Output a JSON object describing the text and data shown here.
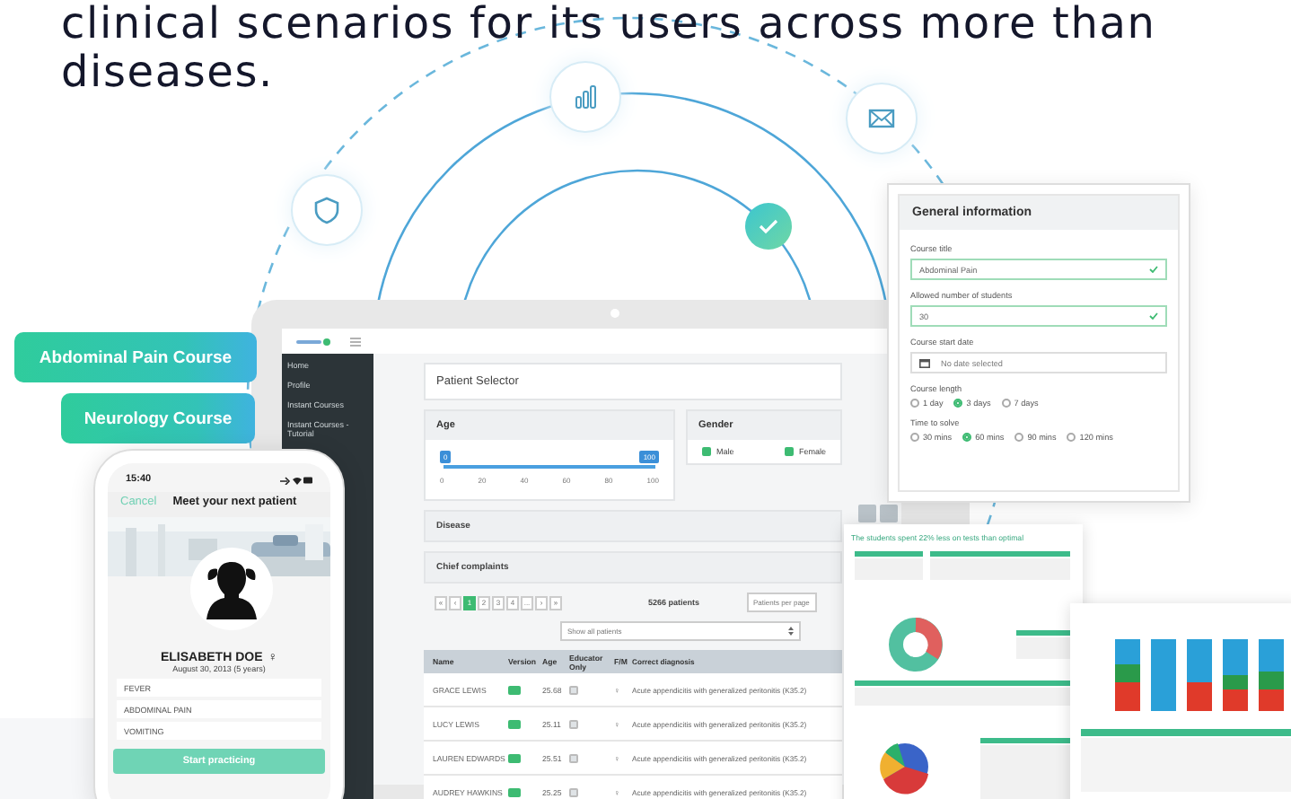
{
  "intro": {
    "lines": [
      "clinical scenarios for its users across more than",
      "diseases."
    ]
  },
  "course_tags": [
    {
      "label": "Abdominal Pain Course"
    },
    {
      "label": "Neurology Course"
    }
  ],
  "phone": {
    "time": "15:40",
    "cancel": "Cancel",
    "title": "Meet your next patient",
    "patient_name": "ELISABETH DOE",
    "gender_symbol": "♀",
    "birth": "August 30, 2013 (5 years)",
    "complaints": [
      "FEVER",
      "ABDOMINAL PAIN",
      "VOMITING"
    ],
    "button": "Start practicing"
  },
  "laptop": {
    "sidebar": [
      {
        "label": "Home"
      },
      {
        "label": "Profile"
      },
      {
        "label": "Instant Courses"
      },
      {
        "label": "Instant Courses - Tutorial"
      }
    ],
    "panel_title": "Patient Selector",
    "age": {
      "label": "Age",
      "min": "0",
      "max": "100",
      "ticks": [
        "0",
        "20",
        "40",
        "60",
        "80",
        "100"
      ]
    },
    "gender": {
      "label": "Gender",
      "options": [
        {
          "label": "Male",
          "checked": true
        },
        {
          "label": "Female",
          "checked": true
        }
      ]
    },
    "sections": [
      "Disease",
      "Chief complaints"
    ],
    "pages": [
      {
        "label": "«",
        "selected": false
      },
      {
        "label": "‹",
        "selected": false
      },
      {
        "label": "1",
        "selected": true
      },
      {
        "label": "2",
        "selected": false
      },
      {
        "label": "3",
        "selected": false
      },
      {
        "label": "4",
        "selected": false
      },
      {
        "label": "...",
        "selected": false
      },
      {
        "label": "›",
        "selected": false
      },
      {
        "label": "»",
        "selected": false
      }
    ],
    "count": "5266 patients",
    "per_page": "Patients per page",
    "filter": "Show all patients",
    "table": {
      "columns": [
        "Name",
        "Version",
        "Age",
        "Educator Only",
        "F/M",
        "Correct diagnosis"
      ],
      "rows": [
        {
          "name": "GRACE LEWIS",
          "age": "25.68",
          "educator_only": false,
          "sex": "♀",
          "diagnosis": "Acute appendicitis with generalized peritonitis (K35.2)"
        },
        {
          "name": "LUCY LEWIS",
          "age": "25.11",
          "educator_only": false,
          "sex": "♀",
          "diagnosis": "Acute appendicitis with generalized peritonitis (K35.2)"
        },
        {
          "name": "LAUREN EDWARDS",
          "age": "25.51",
          "educator_only": false,
          "sex": "♀",
          "diagnosis": "Acute appendicitis with generalized peritonitis (K35.2)"
        },
        {
          "name": "AUDREY HAWKINS",
          "age": "25.25",
          "educator_only": false,
          "sex": "♀",
          "diagnosis": "Acute appendicitis with generalized peritonitis (K35.2)"
        }
      ]
    }
  },
  "general_info": {
    "title": "General information",
    "fields": [
      {
        "kind": "text",
        "label": "Course title",
        "value": "Abdominal Pain",
        "valid": true
      },
      {
        "kind": "text",
        "label": "Allowed number of students",
        "value": "30",
        "valid": true
      },
      {
        "kind": "date",
        "label": "Course start date",
        "placeholder": "No date selected"
      },
      {
        "kind": "radio",
        "label": "Course length",
        "options": [
          {
            "label": "1 day",
            "selected": false
          },
          {
            "label": "3 days",
            "selected": true
          },
          {
            "label": "7 days",
            "selected": false
          }
        ]
      },
      {
        "kind": "radio",
        "label": "Time to solve",
        "options": [
          {
            "label": "30 mins",
            "selected": false
          },
          {
            "label": "60 mins",
            "selected": true
          },
          {
            "label": "90 mins",
            "selected": false
          },
          {
            "label": "120 mins",
            "selected": false
          }
        ]
      }
    ]
  },
  "report": {
    "title": "The students spent 22% less on tests than optimal"
  }
}
